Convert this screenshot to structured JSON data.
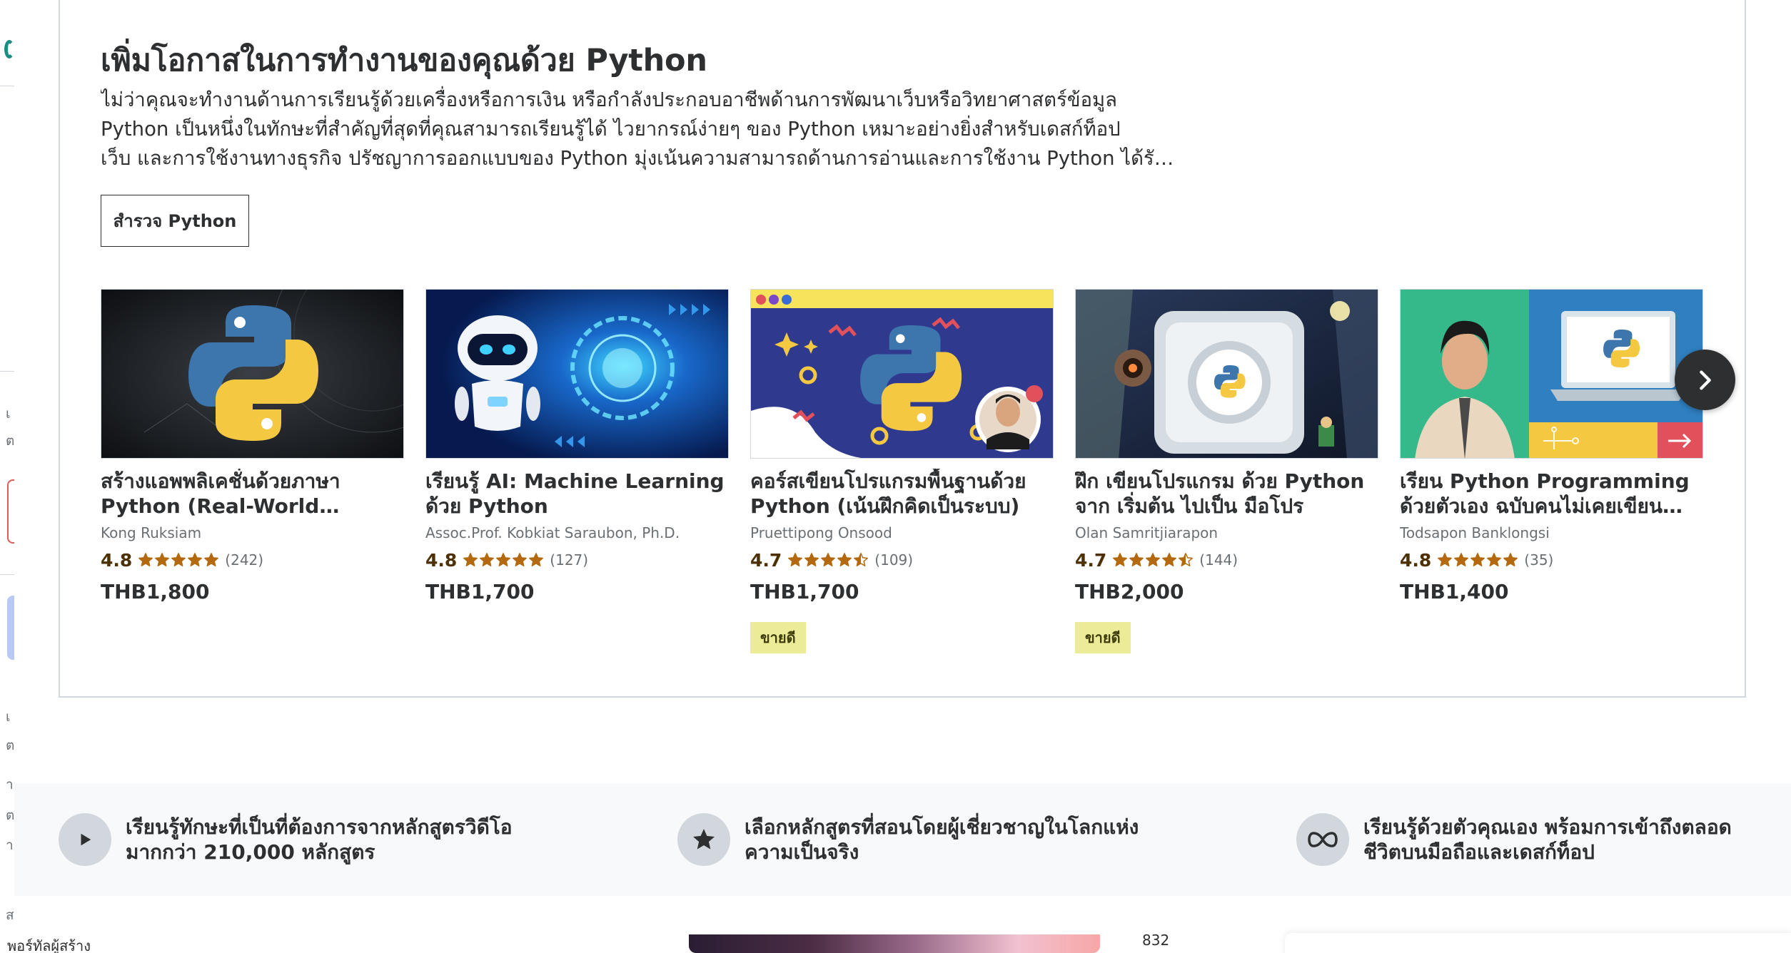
{
  "section": {
    "title": "เพิ่มโอกาสในการทำงานของคุณด้วย Python",
    "description_lines": [
      "ไม่ว่าคุณจะทำงานด้านการเรียนรู้ด้วยเครื่องหรือการเงิน หรือกำลังประกอบอาชีพด้านการพัฒนาเว็บหรือวิทยาศาสตร์ข้อมูล",
      "Python เป็นหนึ่งในทักษะที่สำคัญที่สุดที่คุณสามารถเรียนรู้ได้ ไวยากรณ์ง่ายๆ ของ Python เหมาะอย่างยิ่งสำหรับเดสก์ท็อป",
      "เว็บ และการใช้งานทางธุรกิจ ปรัชญาการออกแบบของ Python มุ่งเน้นความสามารถด้านการอ่านและการใช้งาน Python ได้รั…"
    ],
    "explore_button": "สำรวจ Python"
  },
  "courses": [
    {
      "title": "สร้างแอพพลิเคชั่นด้วยภาษา Python (Real-World Projects)",
      "instructor": "Kong Ruksiam",
      "rating": "4.8",
      "stars": 5,
      "reviews": "(242)",
      "price": "THB1,800",
      "badge": "",
      "thumb_icon": "python-logo-icon"
    },
    {
      "title": "เรียนรู้ AI: Machine Learning ด้วย Python",
      "instructor": "Assoc.Prof. Kobkiat Saraubon, Ph.D.",
      "rating": "4.8",
      "stars": 5,
      "reviews": "(127)",
      "price": "THB1,700",
      "badge": "",
      "thumb_icon": "robot-icon"
    },
    {
      "title": "คอร์สเขียนโปรแกรมพื้นฐานด้วย Python (เน้นฝึกคิดเป็นระบบ)",
      "instructor": "Pruettipong Onsood",
      "rating": "4.7",
      "stars": 4.5,
      "reviews": "(109)",
      "price": "THB1,700",
      "badge": "ขายดี",
      "thumb_icon": "python-logo-icon"
    },
    {
      "title": "ฝึก เขียนโปรแกรม ด้วย Python จาก เริ่มต้น ไปเป็น มือโปร",
      "instructor": "Olan Samritjiarapon",
      "rating": "4.7",
      "stars": 4.5,
      "reviews": "(144)",
      "price": "THB2,000",
      "badge": "ขายดี",
      "thumb_icon": "robot-icon"
    },
    {
      "title": "เรียน Python Programming ด้วยตัวเอง ฉบับคนไม่เคยเขียนโปรแกรม",
      "instructor": "Todsapon Banklongsi",
      "rating": "4.8",
      "stars": 5,
      "reviews": "(35)",
      "price": "THB1,400",
      "badge": "",
      "thumb_icon": "laptop-icon"
    }
  ],
  "value_props": [
    {
      "icon": "play-icon",
      "text": "เรียนรู้ทักษะที่เป็นที่ต้องการจากหลักสูตรวิดีโอมากกว่า 210,000 หลักสูตร"
    },
    {
      "icon": "star-icon",
      "text": "เลือกหลักสูตรที่สอนโดยผู้เชี่ยวชาญในโลกแห่งความเป็นจริง"
    },
    {
      "icon": "infinity-icon",
      "text": "เรียนรู้ด้วยตัวคุณเอง พร้อมการเข้าถึงตลอดชีวิตบนมือถือและเดสก์ท็อป"
    }
  ],
  "bottom": {
    "left_label": "พอร์ทัลผู้สร้าง",
    "number": "832"
  },
  "left_strip_chars": [
    "เ",
    "ต",
    "เ",
    "ต",
    "า",
    "ต",
    "า",
    "ส"
  ],
  "colors": {
    "accent": "#2d2f31",
    "star": "#b4690e",
    "rating_text": "#4d3105",
    "badge_bg": "#eceb98",
    "band_bg": "#f7f9fa"
  }
}
